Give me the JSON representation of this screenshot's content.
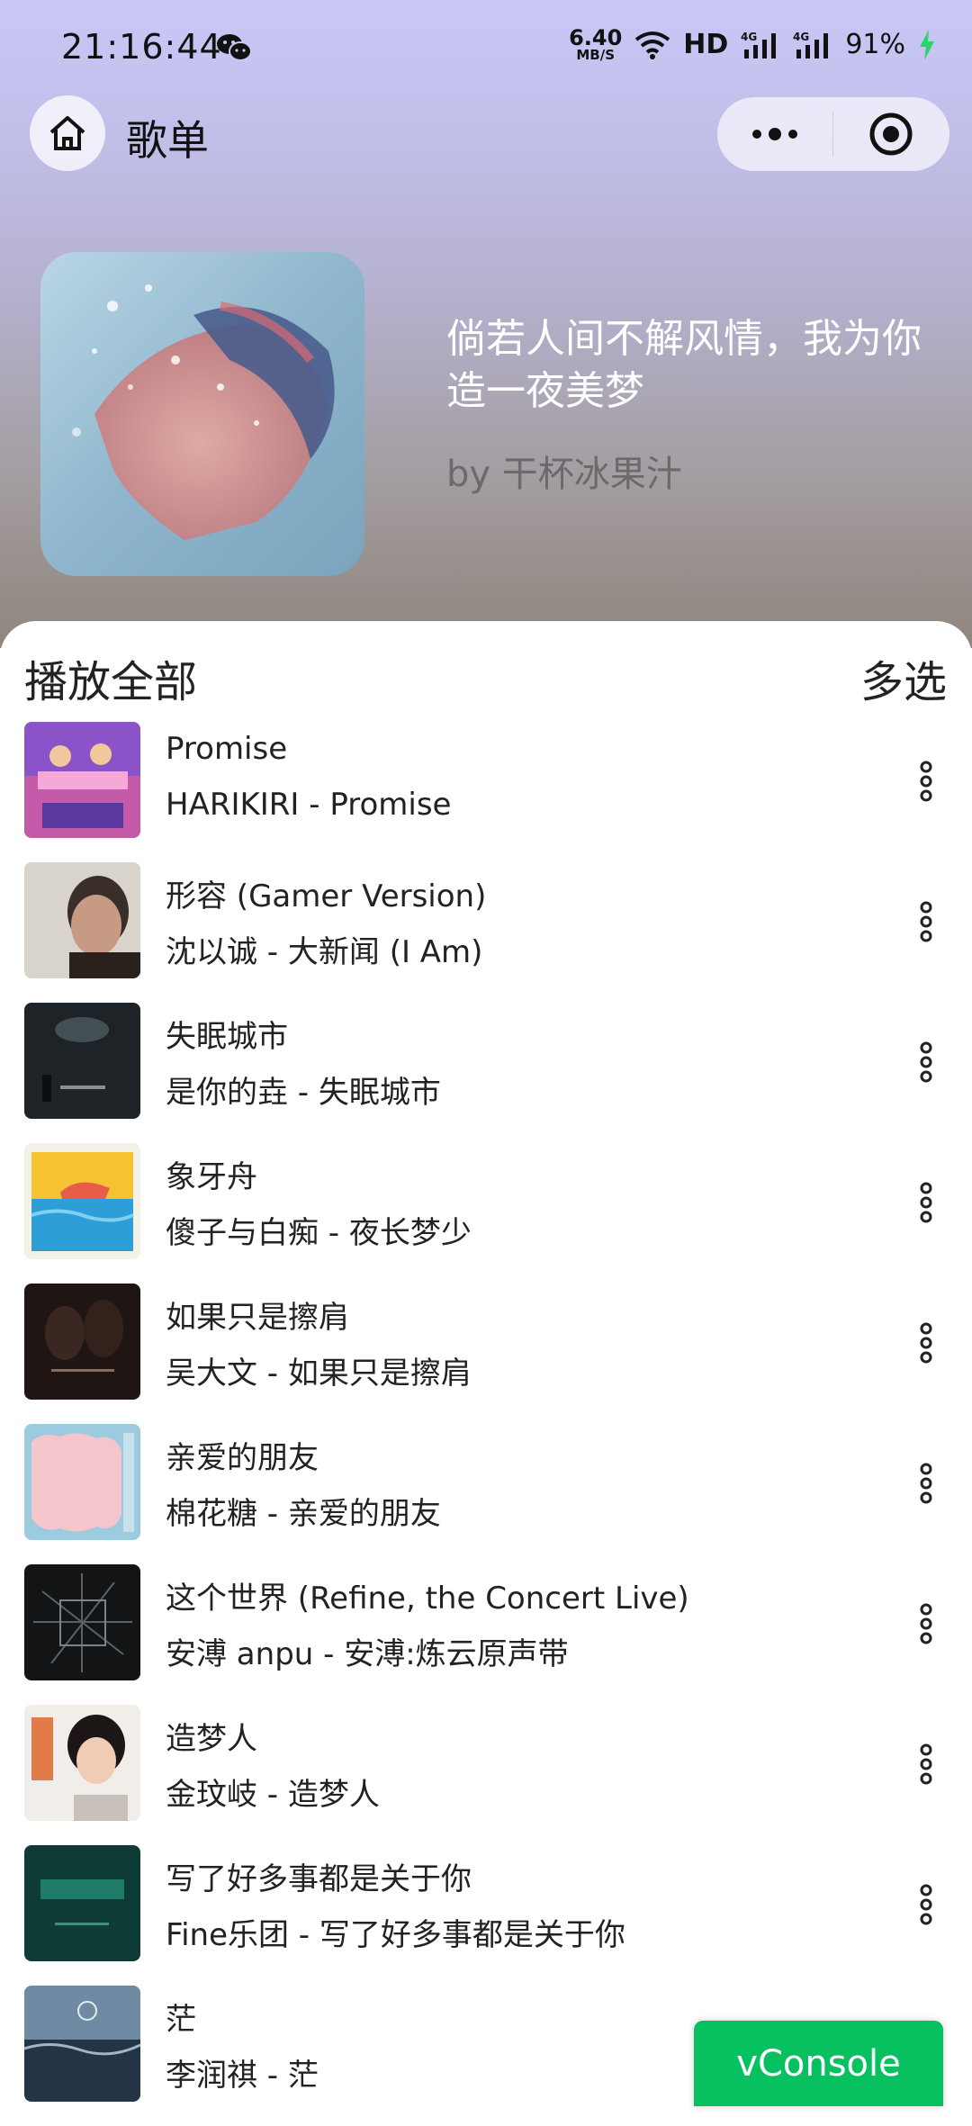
{
  "status_bar": {
    "time": "21:16:44",
    "speed_value": "6.40",
    "speed_unit": "MB/S",
    "hd": "HD",
    "network1": "4G",
    "network2": "4G",
    "battery": "91%"
  },
  "nav": {
    "title": "歌单",
    "home_icon": "home-icon",
    "more_icon": "more-dots-icon",
    "close_icon": "target-icon"
  },
  "playlist": {
    "title": "倘若人间不解风情，我为你造一夜美梦",
    "author": "by 干杯冰果汁"
  },
  "list_header": {
    "play_all": "播放全部",
    "multi_select": "多选"
  },
  "songs": [
    {
      "name": "Promise",
      "sub": "HARIKIRI - Promise"
    },
    {
      "name": "形容 (Gamer Version)",
      "sub": "沈以诚 - 大新闻 (I Am)"
    },
    {
      "name": "失眠城市",
      "sub": "是你的垚 - 失眠城市"
    },
    {
      "name": "象牙舟",
      "sub": "傻子与白痴 - 夜长梦少"
    },
    {
      "name": "如果只是擦肩",
      "sub": "吴大文 - 如果只是擦肩"
    },
    {
      "name": "亲爱的朋友",
      "sub": "棉花糖 - 亲爱的朋友"
    },
    {
      "name": "这个世界 (Refine, the Concert Live)",
      "sub": "安溥 anpu - 安溥:炼云原声带"
    },
    {
      "name": "造梦人",
      "sub": "金玟岐 - 造梦人"
    },
    {
      "name": "写了好多事都是关于你",
      "sub": "Fine乐团 - 写了好多事都是关于你"
    },
    {
      "name": "茫",
      "sub": "李润祺 - 茫"
    }
  ],
  "vconsole": "vConsole",
  "colors": {
    "vconsole_green": "#07c160",
    "hero_top": "#c9c7f6",
    "hero_bottom": "#8f857e"
  }
}
